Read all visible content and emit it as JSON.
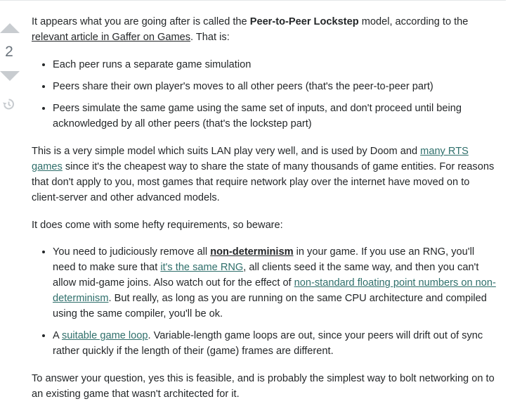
{
  "vote": {
    "count": "2",
    "up_icon": "arrow-up-icon",
    "down_icon": "arrow-down-icon",
    "history_icon": "history-icon"
  },
  "post": {
    "intro": {
      "t1": "It appears what you are going after is called the ",
      "bold": "Peer-to-Peer Lockstep",
      "t2": " model, according to the ",
      "link": "relevant article in Gaffer on Games",
      "t3": ". That is:"
    },
    "bullets1": [
      "Each peer runs a separate game simulation",
      "Peers share their own player's moves to all other peers (that's the peer-to-peer part)",
      "Peers simulate the same game using the same set of inputs, and don't proceed until being acknowledged by all other peers (that's the lockstep part)"
    ],
    "para2": {
      "t1": "This is a very simple model which suits LAN play very well, and is used by Doom and ",
      "link": "many RTS games",
      "t2": " since it's the cheapest way to share the state of many thousands of game entities. For reasons that don't apply to you, most games that require network play over the internet have moved on to client-server and other advanced models."
    },
    "para3": "It does come with some hefty requirements, so beware:",
    "bullet_nd": {
      "t1": "You need to judiciously remove all ",
      "link_bold": "non-determinism",
      "t2": " in your game. If you use an RNG, you'll need to make sure that ",
      "link_rng": "it's the same RNG",
      "t3": ", all clients seed it the same way, and then you can't allow mid-game joins. Also watch out for the effect of ",
      "link_fp": "non-standard floating point numbers on non-determinism",
      "t4": ". But really, as long as you are running on the same CPU architecture and compiled using the same compiler, you'll be ok."
    },
    "bullet_loop": {
      "t1": "A ",
      "link": "suitable game loop",
      "t2": ". Variable-length game loops are out, since your peers will drift out of sync rather quickly if the length of their (game) frames are different."
    },
    "conclusion": "To answer your question, yes this is feasible, and is probably the simplest way to bolt networking on to an existing game that wasn't architected for it."
  },
  "colors": {
    "text": "#242729",
    "link": "#2f6f6b",
    "vote_arrow": "#c8ccd0",
    "vote_count": "#6a737c"
  }
}
